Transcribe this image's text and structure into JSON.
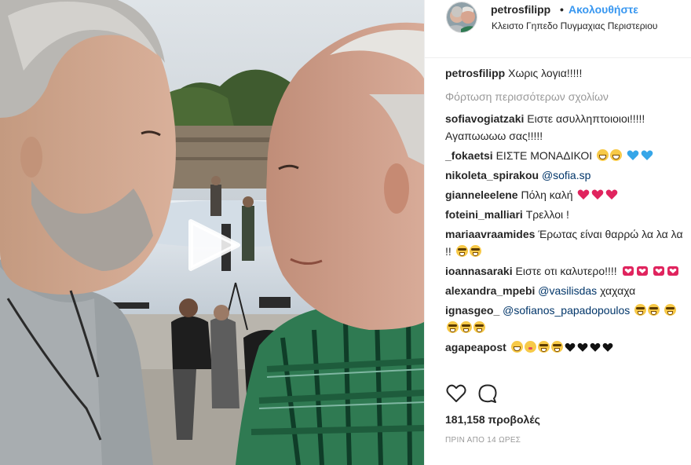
{
  "header": {
    "username": "petrosfilipp",
    "separator": "•",
    "follow_label": "Ακολουθήστε",
    "location": "Κλειστο Γηπεδο Πυγμαχιας Περιστεριου",
    "avatar_icon": "profile-avatar"
  },
  "caption": {
    "username": "petrosfilipp",
    "text": "Χωρις λογια!!!!!"
  },
  "load_more_label": "Φόρτωση περισσότερων σχολίων",
  "comments": [
    {
      "username": "sofiavogiatzaki",
      "text": "Ειστε ασυλληπτοιοιοι!!!!! Αγαπωωωω σας!!!!!"
    },
    {
      "username": "_fokaetsi",
      "text": "ΕΙΣΤΕ ΜΟΝΑΔΙΚΟΙ",
      "emojis": [
        "grinning-face",
        "grinning-face",
        "blue-heart",
        "blue-heart"
      ]
    },
    {
      "username": "nikoleta_spirakou",
      "mention": "@sofia.sp",
      "text": ""
    },
    {
      "username": "gianneleelene",
      "text": "Πόλη καλή",
      "emojis": [
        "red-heart",
        "red-heart",
        "red-heart"
      ]
    },
    {
      "username": "foteini_malliari",
      "text": "Τρελλοι !"
    },
    {
      "username": "mariaavraamides",
      "text": "Έρωτας είναι θαρρώ λα λα λα !!",
      "emojis": [
        "grinning-sweat",
        "grinning-sweat"
      ]
    },
    {
      "username": "ioannasaraki",
      "text": "Ειστε οτι καλυτερο!!!!",
      "emojis": [
        "heart-face",
        "heart-face",
        "heart-face",
        "heart-face"
      ]
    },
    {
      "username": "alexandra_mpebi",
      "mention": "@vasilisdas",
      "text": "χαχαχα"
    },
    {
      "username": "ignasgeo_",
      "mention": "@sofianos_papadopoulos",
      "text": "",
      "emojis": [
        "grinning-sweat",
        "grinning-sweat",
        "grinning-sweat",
        "grinning-sweat",
        "grinning-sweat",
        "grinning-sweat"
      ]
    },
    {
      "username": "agapeapost",
      "text": "",
      "emojis": [
        "grinning-face",
        "expressionless-face",
        "grinning-sweat",
        "grinning-sweat",
        "black-heart",
        "black-heart",
        "black-heart",
        "black-heart"
      ]
    }
  ],
  "actions": {
    "like_icon": "heart-outline-icon",
    "comment_icon": "comment-bubble-icon"
  },
  "stats": {
    "views_count": "181,158",
    "views_label": "προβολές"
  },
  "timestamp": "ΠΡΙΝ ΑΠΟ 14 ΩΡΕΣ",
  "colors": {
    "link_blue": "#3897f0",
    "mention_blue": "#003569",
    "muted_gray": "#999999",
    "text": "#262626",
    "border": "#efefef"
  }
}
